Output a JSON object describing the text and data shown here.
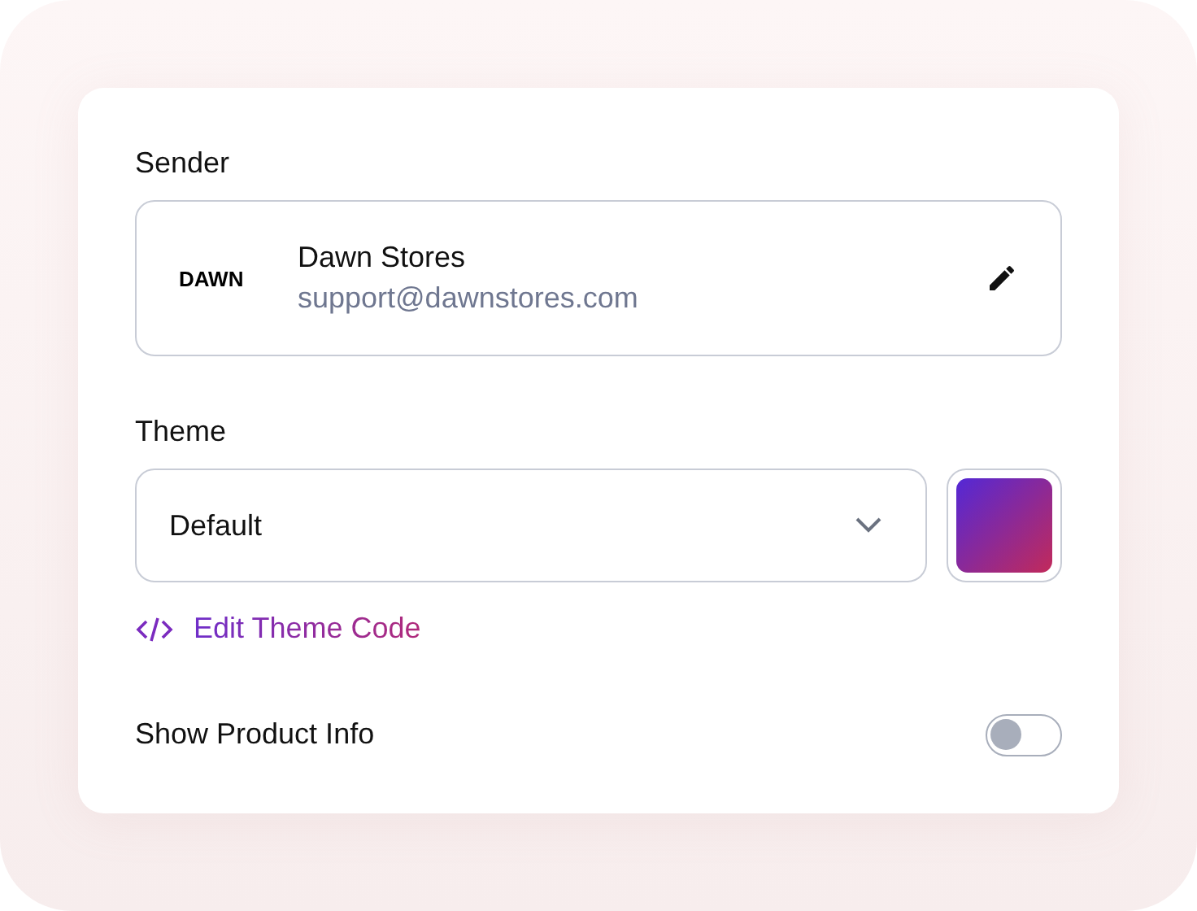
{
  "sender": {
    "label": "Sender",
    "logo": "DAWN",
    "name": "Dawn Stores",
    "email": "support@dawnstores.com"
  },
  "theme": {
    "label": "Theme",
    "value": "Default",
    "link": "Edit Theme Code"
  },
  "toggle": {
    "label": "Show Product Info",
    "on": false
  }
}
